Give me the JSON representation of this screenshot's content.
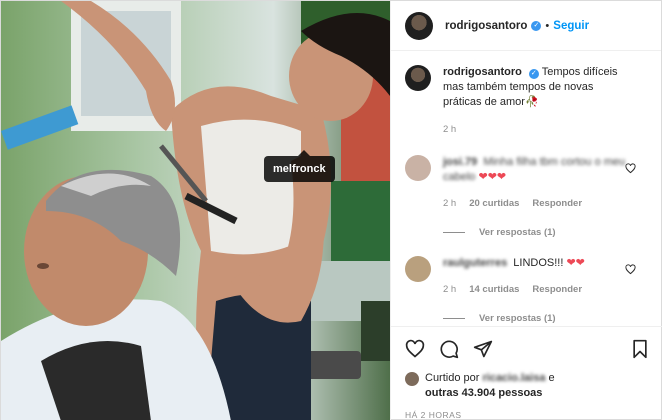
{
  "photo": {
    "tag_username": "melfronck"
  },
  "header": {
    "username": "rodrigosantoro",
    "verified_mark": "✓",
    "separator": "•",
    "follow_label": "Seguir"
  },
  "caption": {
    "username": "rodrigosantoro",
    "text": "Tempos difíceis mas também tempos de novas práticas de amor",
    "emoji": "🥀",
    "time": "2 h"
  },
  "comments": [
    {
      "username": "josi.79",
      "text": "Minha filha tbm cortou o meu cabelo",
      "hearts": "❤❤❤",
      "time": "2 h",
      "likes": "20 curtidas",
      "reply_label": "Responder",
      "view_replies": "Ver respostas (1)",
      "avatar_color": "#c9b2a5"
    },
    {
      "username": "raulguterres",
      "text": "LINDOS!!!",
      "hearts": "❤❤",
      "time": "2 h",
      "likes": "14 curtidas",
      "reply_label": "Responder",
      "view_replies": "Ver respostas (1)",
      "avatar_color": "#b9a07e"
    }
  ],
  "likes": {
    "prefix": "Curtido por",
    "user": "ricacio.laisa",
    "connector": "e",
    "others": "outras 43.904 pessoas"
  },
  "timestamp": "HÁ 2 HORAS",
  "icons": [
    "heart-icon",
    "comment-icon",
    "share-icon",
    "bookmark-icon"
  ],
  "colors": {
    "link": "#0095f6",
    "verified": "#3897f0",
    "muted": "#8e8e8e",
    "heart": "#ed4956"
  }
}
